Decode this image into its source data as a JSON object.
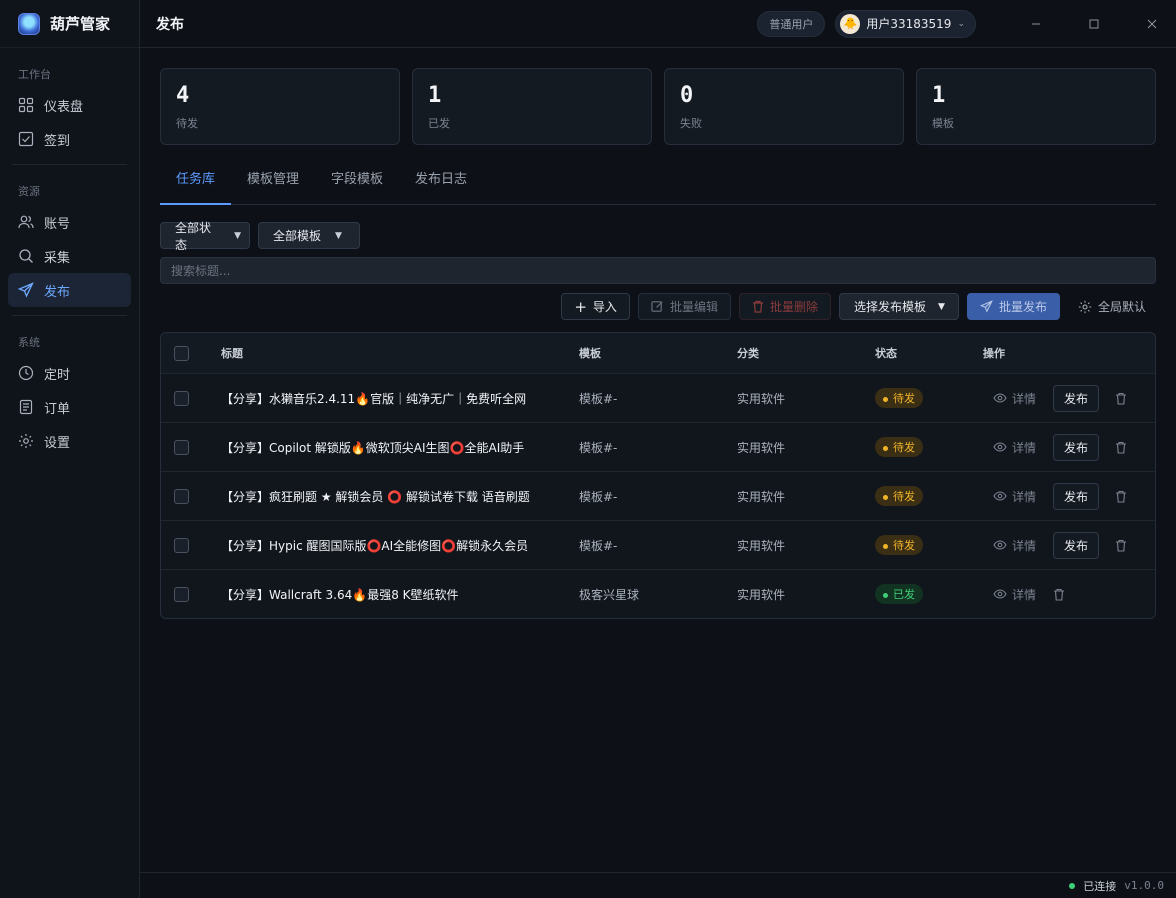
{
  "app": {
    "name": "葫芦管家"
  },
  "sidebar": {
    "sections": [
      {
        "title": "工作台",
        "items": [
          {
            "label": "仪表盘",
            "icon": "dashboard-icon"
          },
          {
            "label": "签到",
            "icon": "checkin-icon"
          }
        ]
      },
      {
        "title": "资源",
        "items": [
          {
            "label": "账号",
            "icon": "user-icon"
          },
          {
            "label": "采集",
            "icon": "search-icon"
          },
          {
            "label": "发布",
            "icon": "send-icon",
            "active": true
          }
        ]
      },
      {
        "title": "系统",
        "items": [
          {
            "label": "定时",
            "icon": "clock-icon"
          },
          {
            "label": "订单",
            "icon": "order-icon"
          },
          {
            "label": "设置",
            "icon": "gear-icon"
          }
        ]
      }
    ]
  },
  "header": {
    "title": "发布",
    "role": "普通用户",
    "username": "用户33183519"
  },
  "stats": [
    {
      "value": "4",
      "label": "待发"
    },
    {
      "value": "1",
      "label": "已发"
    },
    {
      "value": "0",
      "label": "失败"
    },
    {
      "value": "1",
      "label": "模板"
    }
  ],
  "tabs": [
    {
      "label": "任务库",
      "active": true
    },
    {
      "label": "模板管理"
    },
    {
      "label": "字段模板"
    },
    {
      "label": "发布日志"
    }
  ],
  "filters": {
    "status": "全部状态",
    "template": "全部模板",
    "search_placeholder": "搜索标题..."
  },
  "toolbar": {
    "import": "导入",
    "batch_edit": "批量编辑",
    "batch_delete": "批量删除",
    "select_template": "选择发布模板",
    "batch_publish": "批量发布",
    "global_default": "全局默认"
  },
  "table": {
    "headers": {
      "title": "标题",
      "template": "模板",
      "category": "分类",
      "status": "状态",
      "ops": "操作"
    },
    "rows": [
      {
        "title": "【分享】水獭音乐2.4.11🔥官版｜纯净无广｜免费听全网",
        "template": "模板#-",
        "category": "实用软件",
        "status": "待发",
        "state": "pending"
      },
      {
        "title": "【分享】Copilot 解锁版🔥微软顶尖AI生图⭕全能AI助手",
        "template": "模板#-",
        "category": "实用软件",
        "status": "待发",
        "state": "pending"
      },
      {
        "title": "【分享】疯狂刷题 ★ 解锁会员 ⭕ 解锁试卷下载 语音刷题",
        "template": "模板#-",
        "category": "实用软件",
        "status": "待发",
        "state": "pending"
      },
      {
        "title": "【分享】Hypic 醒图国际版⭕AI全能修图⭕解锁永久会员",
        "template": "模板#-",
        "category": "实用软件",
        "status": "待发",
        "state": "pending"
      },
      {
        "title": "【分享】Wallcraft 3.64🔥最强8 K壁纸软件",
        "template": "极客兴星球",
        "category": "实用软件",
        "status": "已发",
        "state": "done"
      }
    ],
    "op_detail": "详情",
    "op_publish": "发布"
  },
  "statusbar": {
    "connection": "已连接",
    "version": "v1.0.0"
  }
}
